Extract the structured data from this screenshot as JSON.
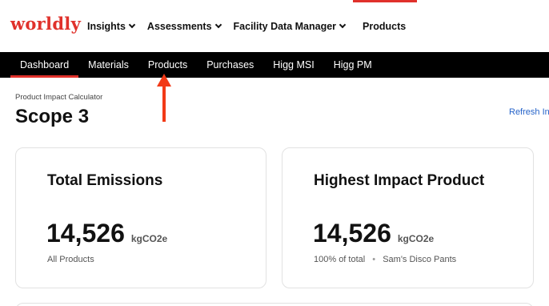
{
  "brand": {
    "logo_text": "worldly",
    "accent_color": "#e0312b"
  },
  "top_nav": {
    "items": [
      {
        "label": "Insights",
        "has_dropdown": true
      },
      {
        "label": "Assessments",
        "has_dropdown": true
      },
      {
        "label": "Facility Data Manager",
        "has_dropdown": true
      },
      {
        "label": "Products",
        "has_dropdown": false,
        "active": true
      }
    ]
  },
  "sub_nav": {
    "items": [
      {
        "label": "Dashboard",
        "active": true
      },
      {
        "label": "Materials"
      },
      {
        "label": "Products"
      },
      {
        "label": "Purchases"
      },
      {
        "label": "Higg MSI"
      },
      {
        "label": "Higg PM"
      }
    ]
  },
  "annotation": {
    "arrow_color": "#f23a17",
    "points_to": "Products"
  },
  "page": {
    "breadcrumb": "Product Impact Calculator",
    "title": "Scope 3",
    "refresh_label": "Refresh In",
    "link_color": "#2563c9"
  },
  "cards": [
    {
      "title": "Total Emissions",
      "value": "14,526",
      "unit": "kgCO2e",
      "footer": "All Products"
    },
    {
      "title": "Highest Impact Product",
      "value": "14,526",
      "unit": "kgCO2e",
      "footer_share": "100% of total",
      "footer_separator": "•",
      "footer_product": "Sam's Disco Pants"
    }
  ]
}
